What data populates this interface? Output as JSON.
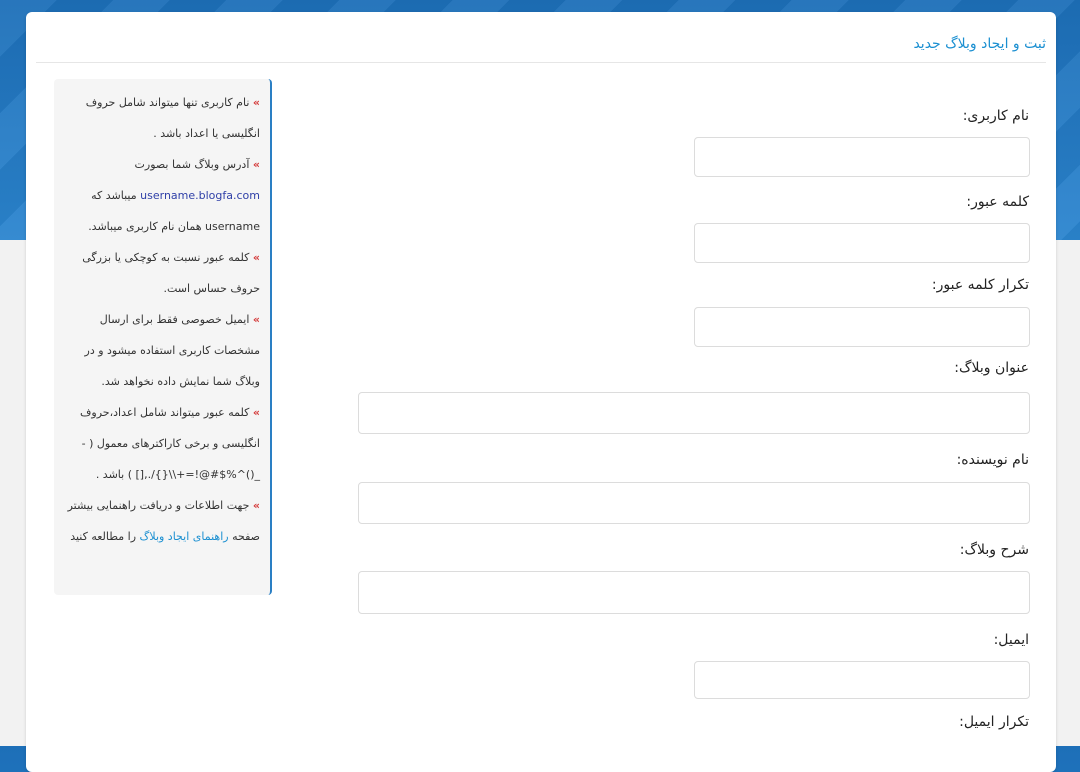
{
  "header": {
    "title": "ثبت و ایجاد وبلاگ جدید"
  },
  "form": {
    "fields": [
      {
        "label": "نام کاربری:"
      },
      {
        "label": "کلمه عبور:"
      },
      {
        "label": "تکرار کلمه عبور:"
      },
      {
        "label": "عنوان وبلاگ:"
      },
      {
        "label": "نام نویسنده:"
      },
      {
        "label": "شرح وبلاگ:"
      },
      {
        "label": "ایمیل:"
      },
      {
        "label": "تکرار ایمیل:"
      }
    ]
  },
  "info": {
    "bullet": "»",
    "p1": "نام کاربری تنها میتواند شامل حروف انگلیسی یا اعداد باشد .",
    "p2a": "آدرس وبلاگ شما بصورت",
    "p2_link": "username.blogfa.com",
    "p2b": "میباشد که username همان نام کاربری میباشد.",
    "p3": "کلمه عبور نسبت به کوچکی یا بزرگی حروف حساس است.",
    "p4": "ایمیل خصوصی فقط برای ارسال مشخصات کاربری استفاده میشود و در وبلاگ شما نمایش داده نخواهد شد.",
    "p5": "کلمه عبور میتواند شامل اعداد،حروف انگلیسی و برخی کاراکترهای معمول ( -_()^%$#@!=+\\\\{}/.,[] ) باشد .",
    "p6a": "جهت اطلاعات و دریافت راهنمایی بیشتر صفحه",
    "p6_link": "راهنمای ایجاد وبلاگ",
    "p6b": "را مطالعه کنید"
  }
}
